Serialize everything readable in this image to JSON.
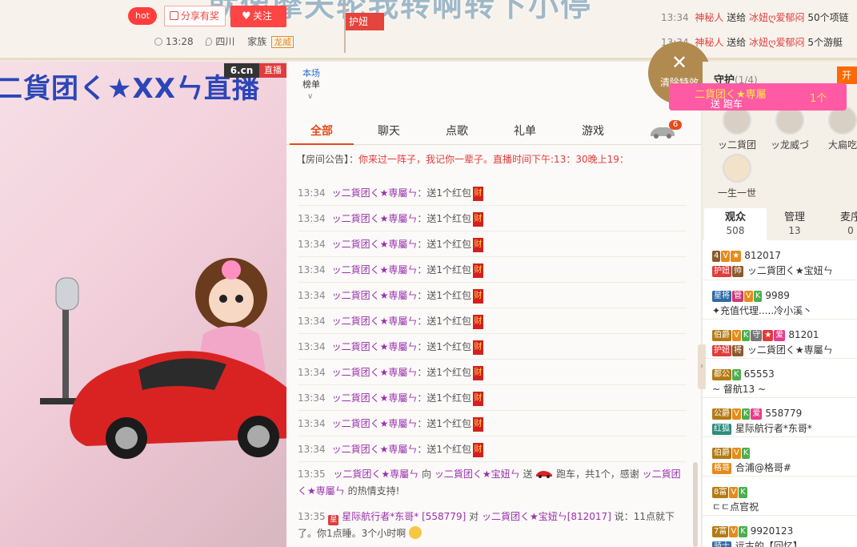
{
  "header": {
    "stream_title": "就像摩天轮我转啊转下小停",
    "hot_label": "hot",
    "share_label": "分享有奖",
    "follow_label": "关注",
    "time": "13:28",
    "location": "四川",
    "family_label": "家族",
    "family_name": "龙威",
    "guard_flag": "护妞"
  },
  "gift_feed": [
    {
      "time": "13:34",
      "sender": "神秘人",
      "verb": "送给",
      "receiver": "冰妞ღ爱郁闷",
      "gift": "50个项链"
    },
    {
      "time": "13:34",
      "sender": "神秘人",
      "verb": "送给",
      "receiver": "冰妞ღ爱郁闷",
      "gift": "5个游艇"
    }
  ],
  "video": {
    "overlay_title": "二貨团く★XXㄣ直播",
    "brand": "6.cn",
    "live_label": "直播"
  },
  "chat": {
    "rank_label_1": "本场",
    "rank_label_2": "榜单",
    "tabs": [
      "全部",
      "聊天",
      "点歌",
      "礼单",
      "游戏"
    ],
    "car_badge": "6",
    "notice_prefix": "【房间公告】：",
    "notice_text": "你来过一阵子，我记你一辈子。直播时间下午:13：30晚上19：",
    "messages": [
      {
        "time": "13:34",
        "user": "ッ二貨团く★専屬ㄣ",
        "content": "送1个红包"
      },
      {
        "time": "13:34",
        "user": "ッ二貨团く★専屬ㄣ",
        "content": "送1个红包"
      },
      {
        "time": "13:34",
        "user": "ッ二貨团く★専屬ㄣ",
        "content": "送1个红包"
      },
      {
        "time": "13:34",
        "user": "ッ二貨团く★専屬ㄣ",
        "content": "送1个红包"
      },
      {
        "time": "13:34",
        "user": "ッ二貨团く★専屬ㄣ",
        "content": "送1个红包"
      },
      {
        "time": "13:34",
        "user": "ッ二貨团く★専屬ㄣ",
        "content": "送1个红包"
      },
      {
        "time": "13:34",
        "user": "ッ二貨团く★専屬ㄣ",
        "content": "送1个红包"
      },
      {
        "time": "13:34",
        "user": "ッ二貨团く★専屬ㄣ",
        "content": "送1个红包"
      },
      {
        "time": "13:34",
        "user": "ッ二貨团く★専屬ㄣ",
        "content": "送1个红包"
      },
      {
        "time": "13:34",
        "user": "ッ二貨团く★専屬ㄣ",
        "content": "送1个红包"
      },
      {
        "time": "13:34",
        "user": "ッ二貨团く★専屬ㄣ",
        "content": "送1个红包"
      }
    ],
    "hongbao_label": "财",
    "gift_msg": {
      "time": "13:35",
      "user": "ッ二貨团く★専屬ㄣ",
      "to_word": "向",
      "target": "ッ二貨团く★宝妞ㄣ",
      "send_word": "送",
      "text": "跑车，共1个，感谢",
      "thanks_user": "ッ二貨团く★専屬ㄣ",
      "tail": "的热情支持!"
    },
    "speech_msg": {
      "time": "13:35",
      "star_tag": "星",
      "user": "星际航行者*东哥*",
      "uid": "[558779]",
      "to_word": "对",
      "target": "ッ二貨团く★宝妞ㄣ",
      "target_uid": "[812017]",
      "say": "说：11点就下了。你1点睡。3个小时啊"
    }
  },
  "effects": {
    "clear_label": "清除特效"
  },
  "right_panel": {
    "guard_title": "守护",
    "guard_count": "(1/4)",
    "open_label": "开",
    "banner_name": "二貨团く★専屬",
    "banner_sub": "送 跑车",
    "banner_qty": "1个",
    "guard_members": [
      "ッ二貨团",
      "ッ龙威づ",
      "大扁吃",
      "一生一世"
    ],
    "aud_tabs": [
      {
        "label": "观众",
        "count": "508"
      },
      {
        "label": "管理",
        "count": "13"
      },
      {
        "label": "麦序",
        "count": "0"
      }
    ],
    "audience": [
      {
        "level": "4",
        "tags": [
          "V",
          "★"
        ],
        "uid": "812017",
        "badge": "护妞",
        "badge2": "帅",
        "name": "ッ二貨团く★宝妞ㄣ"
      },
      {
        "level": "星将",
        "tags": [
          "管",
          "V",
          "K"
        ],
        "uid": "9989",
        "badge": "",
        "badge2": "",
        "name": "✦充值代理.....冷小溪丶"
      },
      {
        "level": "伯爵",
        "tags": [
          "V",
          "K",
          "守",
          "★",
          "爱"
        ],
        "uid": "81201",
        "badge": "护妞",
        "badge2": "将",
        "name": "ッ二貨团く★専屬ㄣ"
      },
      {
        "level": "都公",
        "tags": [
          "K"
        ],
        "uid": "65553",
        "badge": "",
        "badge2": "",
        "name": "~ 督航13 ~"
      },
      {
        "level": "公爵",
        "tags": [
          "V",
          "K",
          "爱"
        ],
        "uid": "558779",
        "badge": "红狐",
        "badge2": "",
        "name": "星际航行者*东哥*"
      },
      {
        "level": "伯爵",
        "tags": [
          "V",
          "K"
        ],
        "uid": "",
        "badge": "格哥",
        "badge2": "",
        "name": "合浦@格哥#"
      },
      {
        "level": "8富",
        "tags": [
          "V",
          "K"
        ],
        "uid": "",
        "badge": "",
        "badge2": "",
        "name": "ㄷㄷ点官祝"
      },
      {
        "level": "7富",
        "tags": [
          "V",
          "K"
        ],
        "uid": "9920123",
        "badge": "骑士",
        "badge2": "",
        "name": "远古的【回忆】"
      }
    ]
  },
  "colors": {
    "accent": "#e64a19",
    "username": "#9b2fae",
    "red": "#e23b3b",
    "clear_btn": "#b08a4f"
  }
}
